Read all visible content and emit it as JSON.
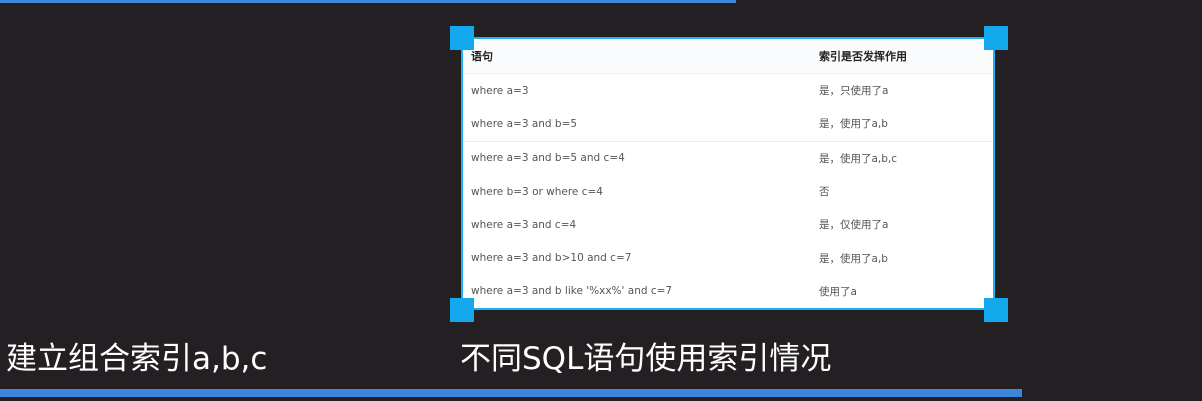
{
  "captions": {
    "left": "建立组合索引a,b,c",
    "right": "不同SQL语句使用索引情况"
  },
  "table": {
    "headers": [
      "语句",
      "索引是否发挥作用"
    ],
    "rows": [
      [
        "where a=3",
        "是，只使用了a"
      ],
      [
        "where a=3 and b=5",
        "是，使用了a,b"
      ],
      [
        "where a=3 and b=5 and c=4",
        "是，使用了a,b,c"
      ],
      [
        "where b=3 or where c=4",
        "否"
      ],
      [
        "where a=3 and c=4",
        "是，仅使用了a"
      ],
      [
        "where a=3 and b>10 and c=7",
        "是，使用了a,b"
      ],
      [
        "where a=3 and b like '%xx%' and c=7",
        "使用了a"
      ]
    ]
  },
  "colors": {
    "background": "#231f23",
    "accent_bar": "#3b86d9",
    "selection": "#1ab2f2"
  }
}
